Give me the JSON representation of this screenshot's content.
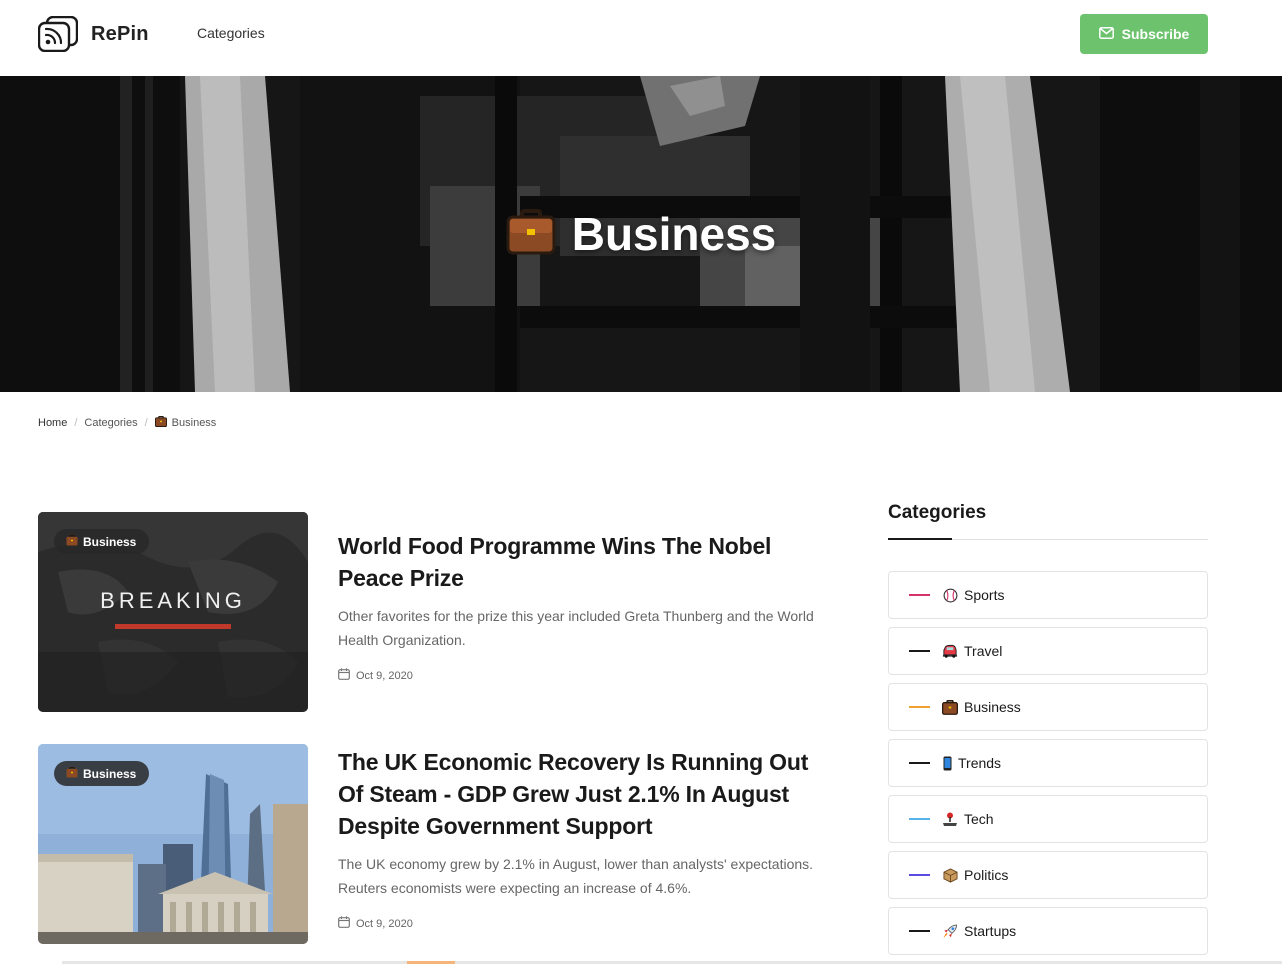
{
  "header": {
    "brand": "RePin",
    "nav": {
      "categories_label": "Categories"
    },
    "subscribe_label": "Subscribe",
    "accent_color": "#6dc36d"
  },
  "hero": {
    "icon": "briefcase-icon",
    "title": "Business"
  },
  "breadcrumb": {
    "home": "Home",
    "categories": "Categories",
    "current": "Business"
  },
  "posts": [
    {
      "badge": "Business",
      "thumbnail_text": "BREAKING",
      "title": "World Food Programme Wins The Nobel Peace Prize",
      "excerpt": "Other favorites for the prize this year included Greta Thunberg and the World Health Organization.",
      "date": "Oct 9, 2020"
    },
    {
      "badge": "Business",
      "title": "The UK Economic Recovery Is Running Out Of Steam - GDP Grew Just 2.1% In August Despite Government Support",
      "excerpt": "The UK economy grew by 2.1% in August, lower than analysts' expectations. Reuters economists were expecting an increase of 4.6%.",
      "date": "Oct 9, 2020"
    }
  ],
  "sidebar": {
    "title": "Categories",
    "categories": [
      {
        "label": "Sports",
        "color": "#d6336c",
        "icon": "baseball-icon"
      },
      {
        "label": "Travel",
        "color": "#1a1a1a",
        "icon": "vehicle-icon"
      },
      {
        "label": "Business",
        "color": "#f0a030",
        "icon": "briefcase-icon"
      },
      {
        "label": "Trends",
        "color": "#1a1a1a",
        "icon": "mobile-phone-icon"
      },
      {
        "label": "Tech",
        "color": "#56b4e9",
        "icon": "joystick-icon"
      },
      {
        "label": "Politics",
        "color": "#5b4be0",
        "icon": "package-icon"
      },
      {
        "label": "Startups",
        "color": "#1a1a1a",
        "icon": "rocket-icon"
      }
    ]
  }
}
